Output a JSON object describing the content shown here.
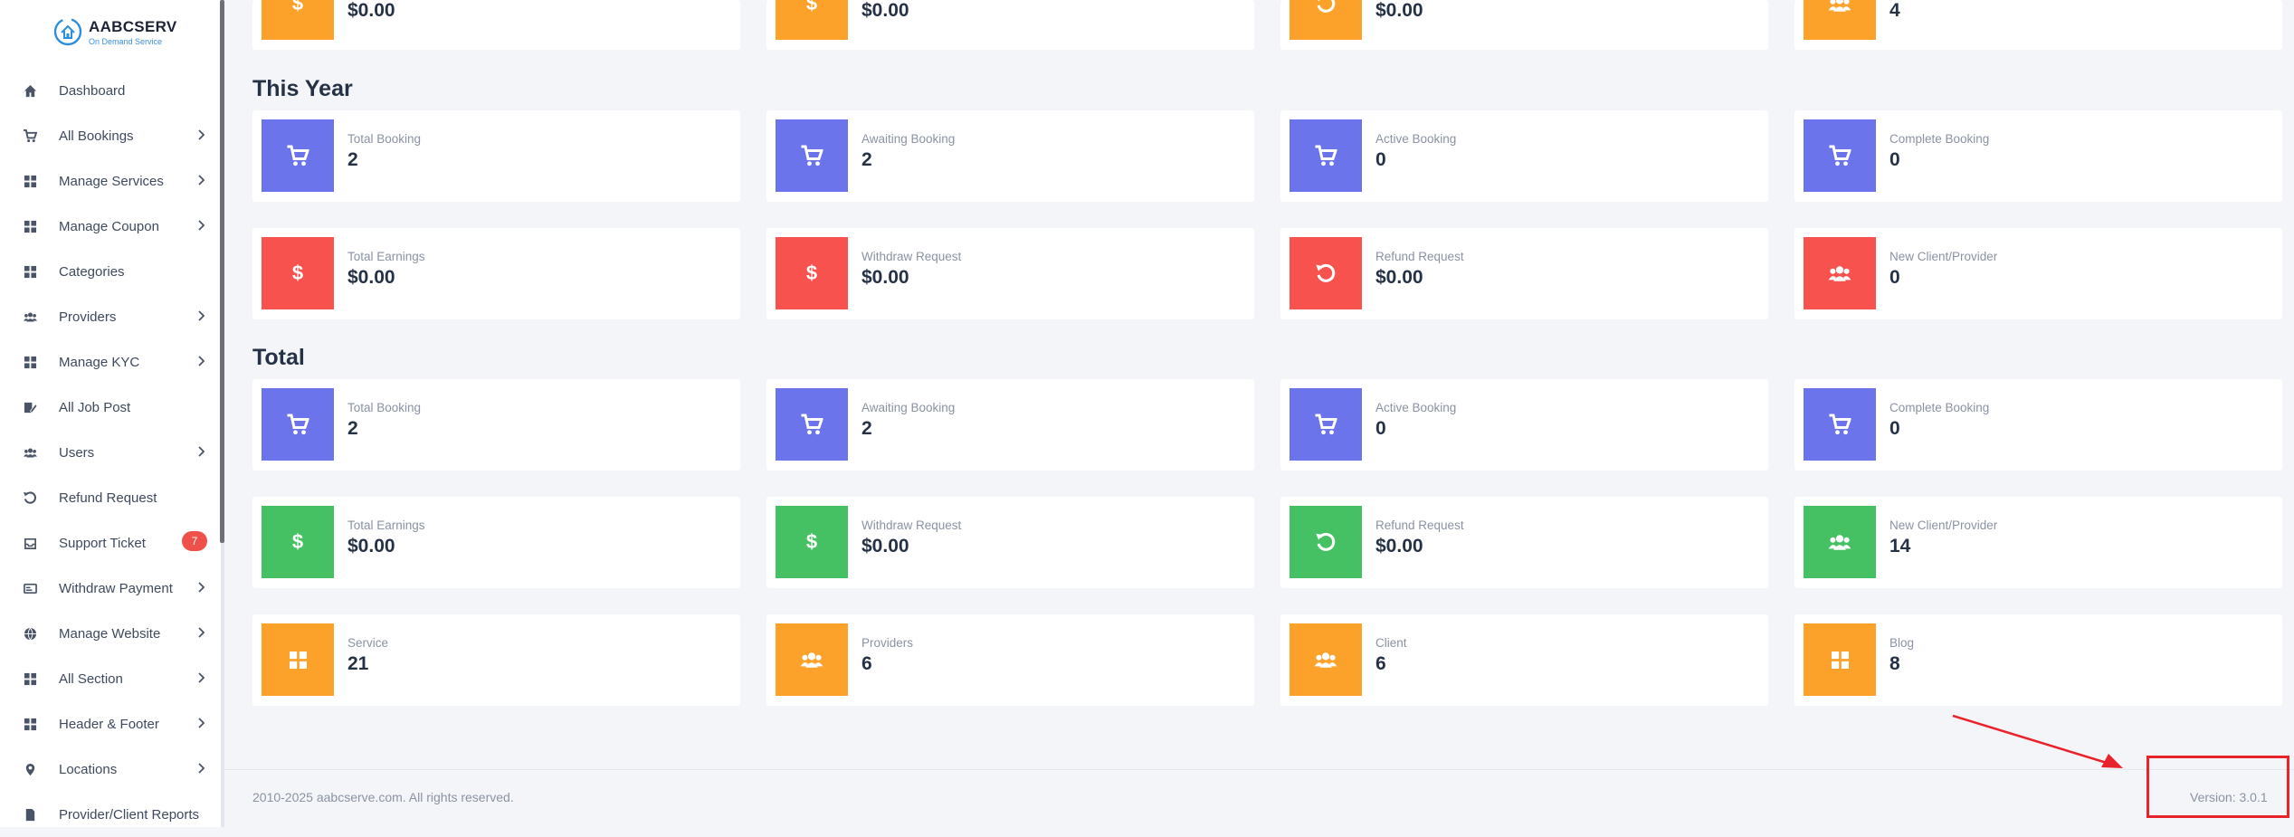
{
  "brand": {
    "title": "AABCSERV",
    "subtitle": "On Demand Service"
  },
  "sidebar": {
    "items": [
      {
        "label": "Dashboard",
        "icon": "home-icon",
        "chevron": false
      },
      {
        "label": "All Bookings",
        "icon": "cart-icon",
        "chevron": true
      },
      {
        "label": "Manage Services",
        "icon": "grid-icon",
        "chevron": true
      },
      {
        "label": "Manage Coupon",
        "icon": "grid-icon",
        "chevron": true
      },
      {
        "label": "Categories",
        "icon": "grid-icon",
        "chevron": false
      },
      {
        "label": "Providers",
        "icon": "users-icon",
        "chevron": true
      },
      {
        "label": "Manage KYC",
        "icon": "grid-icon",
        "chevron": true
      },
      {
        "label": "All Job Post",
        "icon": "edit-icon",
        "chevron": false
      },
      {
        "label": "Users",
        "icon": "users-icon",
        "chevron": true
      },
      {
        "label": "Refund Request",
        "icon": "undo-icon",
        "chevron": false
      },
      {
        "label": "Support Ticket",
        "icon": "inbox-icon",
        "chevron": false,
        "badge": "7"
      },
      {
        "label": "Withdraw Payment",
        "icon": "card-icon",
        "chevron": true
      },
      {
        "label": "Manage Website",
        "icon": "globe-icon",
        "chevron": true
      },
      {
        "label": "All Section",
        "icon": "grid-icon",
        "chevron": true
      },
      {
        "label": "Header & Footer",
        "icon": "grid-icon",
        "chevron": true
      },
      {
        "label": "Locations",
        "icon": "pin-icon",
        "chevron": true
      },
      {
        "label": "Provider/Client Reports",
        "icon": "file-icon",
        "chevron": false
      }
    ]
  },
  "top_row": [
    {
      "value": "$0.00",
      "color": "orange",
      "icon": "dollar-icon"
    },
    {
      "value": "$0.00",
      "color": "orange",
      "icon": "dollar-icon"
    },
    {
      "value": "$0.00",
      "color": "orange",
      "icon": "undo-icon"
    },
    {
      "value": "4",
      "color": "orange",
      "icon": "users-icon"
    }
  ],
  "this_year": {
    "title": "This Year",
    "rows": [
      [
        {
          "label": "Total Booking",
          "value": "2",
          "color": "blue",
          "icon": "cart-icon"
        },
        {
          "label": "Awaiting Booking",
          "value": "2",
          "color": "blue",
          "icon": "cart-icon"
        },
        {
          "label": "Active Booking",
          "value": "0",
          "color": "blue",
          "icon": "cart-icon"
        },
        {
          "label": "Complete Booking",
          "value": "0",
          "color": "blue",
          "icon": "cart-icon"
        }
      ],
      [
        {
          "label": "Total Earnings",
          "value": "$0.00",
          "color": "red",
          "icon": "dollar-icon"
        },
        {
          "label": "Withdraw Request",
          "value": "$0.00",
          "color": "red",
          "icon": "dollar-icon"
        },
        {
          "label": "Refund Request",
          "value": "$0.00",
          "color": "red",
          "icon": "undo-icon"
        },
        {
          "label": "New Client/Provider",
          "value": "0",
          "color": "red",
          "icon": "users-icon"
        }
      ]
    ]
  },
  "total": {
    "title": "Total",
    "rows": [
      [
        {
          "label": "Total Booking",
          "value": "2",
          "color": "blue",
          "icon": "cart-icon"
        },
        {
          "label": "Awaiting Booking",
          "value": "2",
          "color": "blue",
          "icon": "cart-icon"
        },
        {
          "label": "Active Booking",
          "value": "0",
          "color": "blue",
          "icon": "cart-icon"
        },
        {
          "label": "Complete Booking",
          "value": "0",
          "color": "blue",
          "icon": "cart-icon"
        }
      ],
      [
        {
          "label": "Total Earnings",
          "value": "$0.00",
          "color": "green",
          "icon": "dollar-icon"
        },
        {
          "label": "Withdraw Request",
          "value": "$0.00",
          "color": "green",
          "icon": "dollar-icon"
        },
        {
          "label": "Refund Request",
          "value": "$0.00",
          "color": "green",
          "icon": "undo-icon"
        },
        {
          "label": "New Client/Provider",
          "value": "14",
          "color": "green",
          "icon": "users-icon"
        }
      ],
      [
        {
          "label": "Service",
          "value": "21",
          "color": "orange",
          "icon": "grid-icon"
        },
        {
          "label": "Providers",
          "value": "6",
          "color": "orange",
          "icon": "users-icon"
        },
        {
          "label": "Client",
          "value": "6",
          "color": "orange",
          "icon": "users-icon"
        },
        {
          "label": "Blog",
          "value": "8",
          "color": "orange",
          "icon": "grid-icon"
        }
      ]
    ]
  },
  "footer": {
    "copyright": "2010-2025 aabcserve.com. All rights reserved.",
    "version": "Version: 3.0.1"
  },
  "colors": {
    "blue": "#6b74eb",
    "red": "#f7524e",
    "green": "#45c163",
    "orange": "#fca12a",
    "annotation": "#e8232b"
  }
}
